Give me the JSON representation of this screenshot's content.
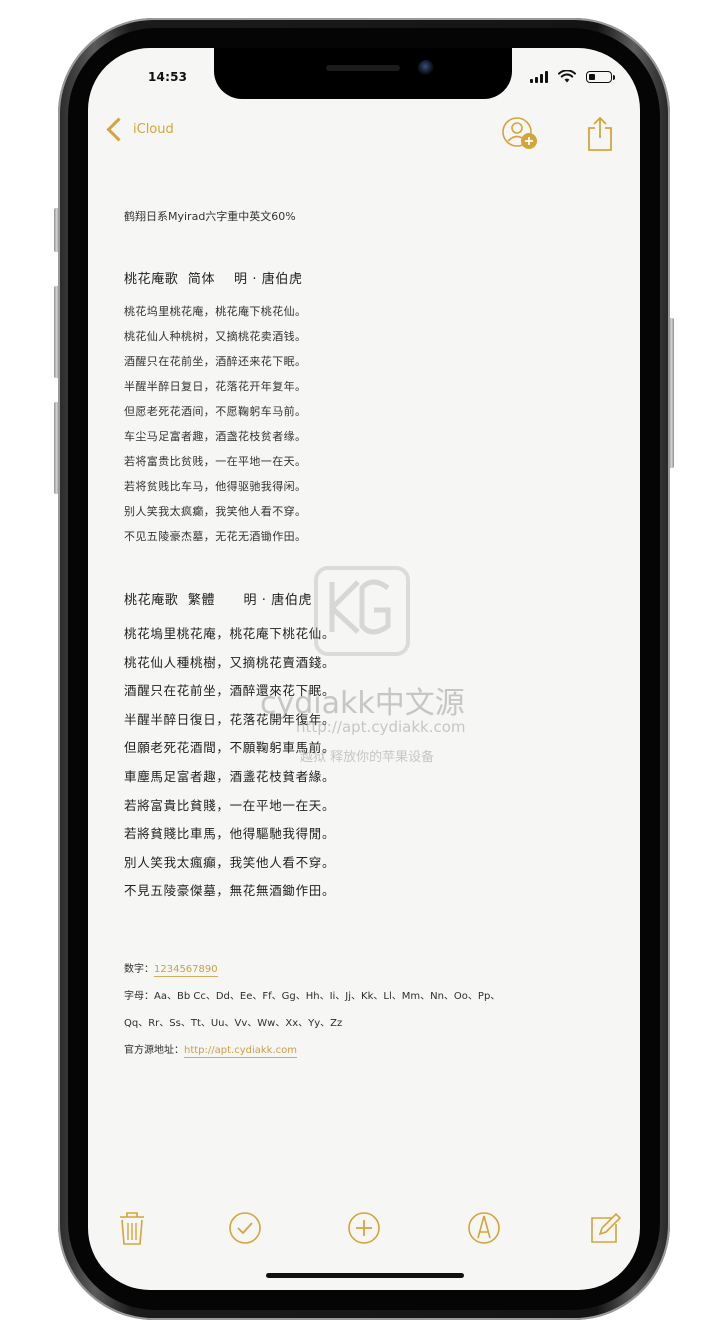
{
  "status_bar": {
    "time": "14:53"
  },
  "nav": {
    "back_label": "iCloud",
    "icons": [
      "chevron-left-icon",
      "add-person-icon",
      "share-icon"
    ]
  },
  "note": {
    "font_title": "鹤翔日系Myirad六字重中英文60%",
    "simplified": {
      "title": "桃花庵歌  简体    明 · 唐伯虎",
      "lines": [
        "桃花坞里桃花庵，桃花庵下桃花仙。",
        "桃花仙人种桃树，又摘桃花卖酒钱。",
        "酒醒只在花前坐，酒醉还来花下眠。",
        "半醒半醉日复日，花落花开年复年。",
        "但愿老死花酒间，不愿鞠躬车马前。",
        "车尘马足富者趣，酒盏花枝贫者缘。",
        "若将富贵比贫贱，一在平地一在天。",
        "若将贫贱比车马，他得驱驰我得闲。",
        "别人笑我太疯癫，我笑他人看不穿。",
        "不见五陵豪杰墓，无花无酒锄作田。"
      ]
    },
    "traditional": {
      "title": "桃花庵歌  繁體      明 · 唐伯虎",
      "lines": [
        "桃花塢里桃花庵，桃花庵下桃花仙。",
        "桃花仙人種桃樹，又摘桃花賣酒錢。",
        "酒醒只在花前坐，酒醉還來花下眠。",
        "半醒半醉日復日，花落花開年復年。",
        "但願老死花酒間，不願鞠躬車馬前。",
        "車塵馬足富者趣，酒盞花枝貧者緣。",
        "若將富貴比貧賤，一在平地一在天。",
        "若將貧賤比車馬，他得驅馳我得閒。",
        "別人笑我太瘋癲，我笑他人看不穿。",
        "不見五陵豪傑墓，無花無酒鋤作田。"
      ]
    },
    "digits_label": "数字：",
    "digits_value": "1234567890",
    "letters_label": "字母：",
    "letters_line1": "Aa、Bb Cc、Dd、Ee、Ff、Gg、Hh、Ii、Jj、Kk、Ll、Mm、Nn、Oo、Pp、",
    "letters_line2": "Qq、Rr、Ss、Tt、Uu、Vv、Ww、Xx、Yy、Zz",
    "source_label": "官方源地址：",
    "source_url": "http://apt.cydiakk.com"
  },
  "watermark": {
    "brand": "cydiakk中文源",
    "url": "http://apt.cydiakk.com",
    "slogan": "越狱 释放你的苹果设备"
  },
  "toolbar": {
    "icons": [
      "trash-icon",
      "checklist-icon",
      "add-icon",
      "markup-pen-icon",
      "compose-icon"
    ]
  },
  "colors": {
    "accent": "#d4a53c",
    "paper": "#f6f6f4",
    "text": "#2b2b2b"
  }
}
